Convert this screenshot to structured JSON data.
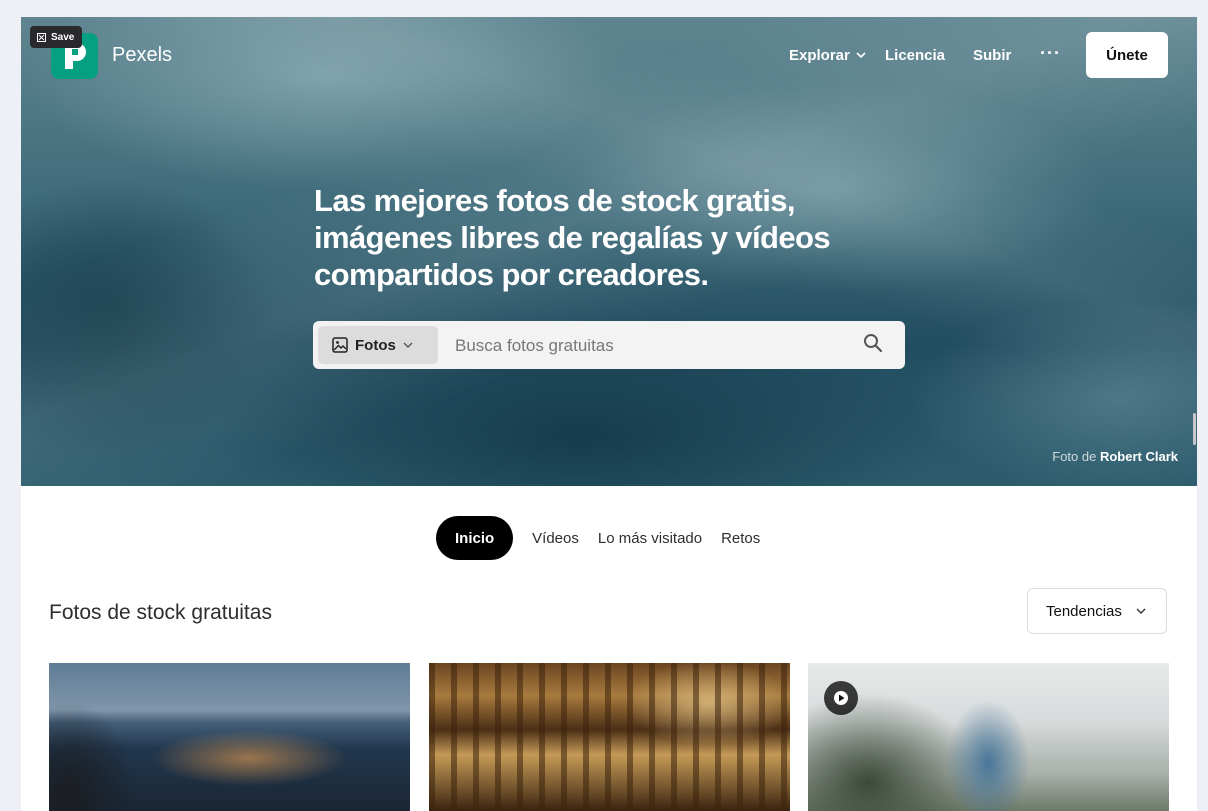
{
  "app": {
    "name": "Pexels",
    "save_label": "Save"
  },
  "nav": {
    "explore_label": "Explorar",
    "license_label": "Licencia",
    "upload_label": "Subir",
    "more_label": "···",
    "join_label": "Únete"
  },
  "hero": {
    "title_lines": [
      "Las mejores fotos de stock gratis,",
      "imágenes libres de regalías y vídeos",
      "compartidos por creadores."
    ],
    "search": {
      "type_label": "Fotos",
      "placeholder": "Busca fotos gratuitas"
    },
    "credit_prefix": "Foto de",
    "credit_author": "Robert Clark"
  },
  "tabs": [
    {
      "label": "Inicio",
      "active": true
    },
    {
      "label": "Vídeos",
      "active": false
    },
    {
      "label": "Lo más visitado",
      "active": false
    },
    {
      "label": "Retos",
      "active": false
    }
  ],
  "section": {
    "title": "Fotos de stock gratuitas",
    "sort_label": "Tendencias"
  },
  "colors": {
    "brand": "#05a081",
    "active_tab": "#000000"
  },
  "icons": {
    "logo": "pexels-logo-icon",
    "explore_chevron": "chevron-down-icon",
    "photo_type": "image-icon",
    "search": "search-icon",
    "sort_chevron": "chevron-down-icon",
    "video": "play-icon"
  }
}
